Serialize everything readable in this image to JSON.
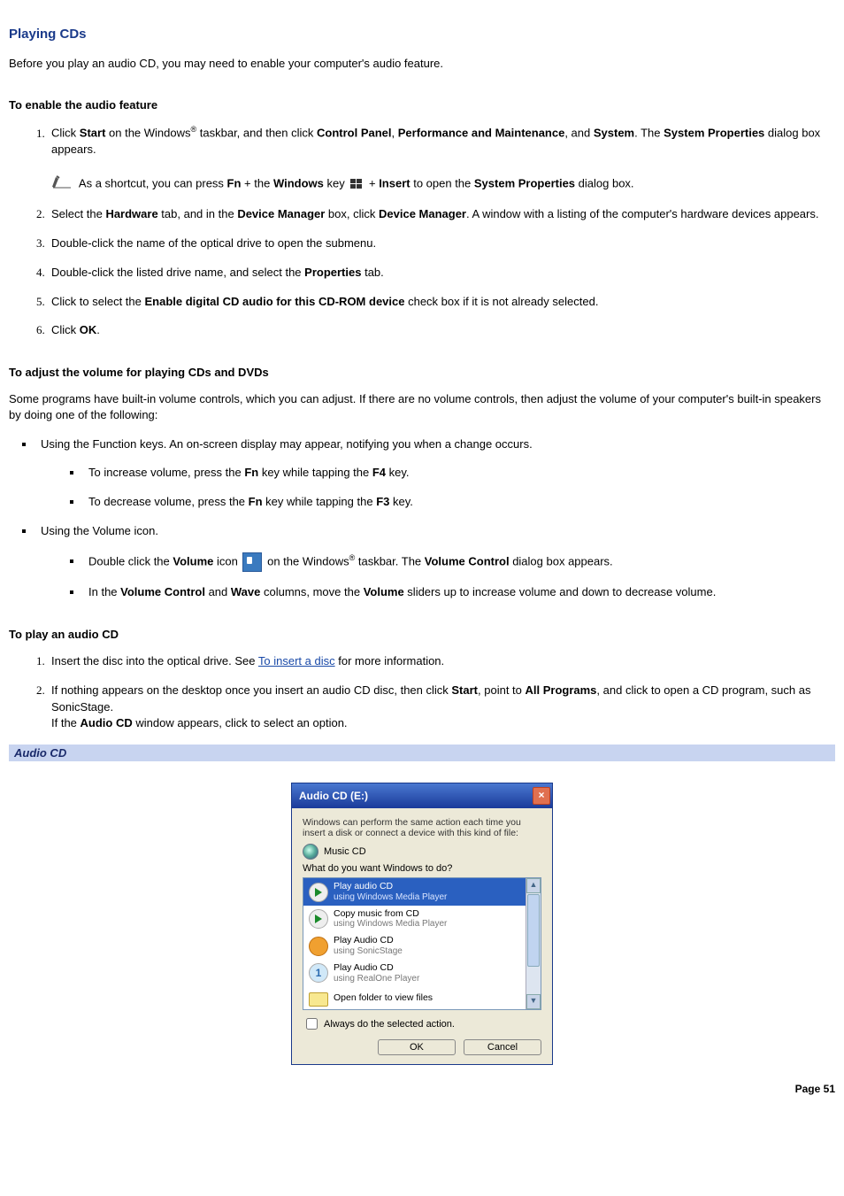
{
  "title": "Playing CDs",
  "intro": "Before you play an audio CD, you may need to enable your computer's audio feature.",
  "sec1_heading": "To enable the audio feature",
  "sec1": {
    "step1_a": "Click ",
    "step1_b": "Start",
    "step1_c": " on the Windows",
    "step1_sup": "®",
    "step1_d": " taskbar, and then click ",
    "step1_e": "Control Panel",
    "step1_f": ", ",
    "step1_g": "Performance and Maintenance",
    "step1_h": ", and ",
    "step1_i": "System",
    "step1_j": ". The ",
    "step1_k": "System Properties",
    "step1_l": " dialog box appears.",
    "note_a": "As a shortcut, you can press ",
    "note_b": "Fn",
    "note_c": " + the ",
    "note_d": "Windows",
    "note_e": " key ",
    "note_f": " + ",
    "note_g": "Insert",
    "note_h": " to open the ",
    "note_i": "System Properties",
    "note_j": " dialog box.",
    "step2_a": "Select the ",
    "step2_b": "Hardware",
    "step2_c": " tab, and in the ",
    "step2_d": "Device Manager",
    "step2_e": " box, click ",
    "step2_f": "Device Manager",
    "step2_g": ". A window with a listing of the computer's hardware devices appears.",
    "step3": "Double-click the name of the optical drive to open the submenu.",
    "step4_a": "Double-click the listed drive name, and select the ",
    "step4_b": "Properties",
    "step4_c": " tab.",
    "step5_a": "Click to select the ",
    "step5_b": "Enable digital CD audio for this CD-ROM device",
    "step5_c": " check box if it is not already selected.",
    "step6_a": "Click ",
    "step6_b": "OK",
    "step6_c": "."
  },
  "sec2_heading": "To adjust the volume for playing CDs and DVDs",
  "sec2_intro": "Some programs have built-in volume controls, which you can adjust. If there are no volume controls, then adjust the volume of your computer's built-in speakers by doing one of the following:",
  "sec2": {
    "b1": "Using the Function keys. An on-screen display may appear, notifying you when a change occurs.",
    "b1_s1_a": "To increase volume, press the ",
    "b1_s1_b": "Fn",
    "b1_s1_c": " key while tapping the ",
    "b1_s1_d": "F4",
    "b1_s1_e": " key.",
    "b1_s2_a": "To decrease volume, press the ",
    "b1_s2_b": "Fn",
    "b1_s2_c": " key while tapping the ",
    "b1_s2_d": "F3",
    "b1_s2_e": " key.",
    "b2": "Using the Volume icon.",
    "b2_s1_a": "Double click the ",
    "b2_s1_b": "Volume",
    "b2_s1_c": " icon ",
    "b2_s1_d": " on the Windows",
    "b2_s1_sup": "®",
    "b2_s1_e": " taskbar. The ",
    "b2_s1_f": "Volume Control",
    "b2_s1_g": " dialog box appears.",
    "b2_s2_a": "In the ",
    "b2_s2_b": "Volume Control",
    "b2_s2_c": " and ",
    "b2_s2_d": "Wave",
    "b2_s2_e": " columns, move the ",
    "b2_s2_f": "Volume",
    "b2_s2_g": " sliders up to increase volume and down to decrease volume."
  },
  "sec3_heading": "To play an audio CD",
  "sec3": {
    "step1_a": "Insert the disc into the optical drive. See ",
    "step1_link": "To insert a disc",
    "step1_b": " for more information.",
    "step2_a": "If nothing appears on the desktop once you insert an audio CD disc, then click ",
    "step2_b": "Start",
    "step2_c": ", point to ",
    "step2_d": "All Programs",
    "step2_e": ", and click to open a CD program, such as SonicStage.",
    "step2_line2_a": "If the ",
    "step2_line2_b": "Audio CD",
    "step2_line2_c": " window appears, click to select an option."
  },
  "caption": "Audio CD",
  "dialog": {
    "title": "Audio CD (E:)",
    "msg": "Windows can perform the same action each time you insert a disk or connect a device with this kind of file:",
    "kind": "Music CD",
    "prompt": "What do you want Windows to do?",
    "items": [
      {
        "main": "Play audio CD",
        "sub": "using Windows Media Player"
      },
      {
        "main": "Copy music from CD",
        "sub": "using Windows Media Player"
      },
      {
        "main": "Play Audio CD",
        "sub": "using SonicStage"
      },
      {
        "main": "Play Audio CD",
        "sub": "using RealOne Player"
      },
      {
        "main": "Open folder to view files",
        "sub": ""
      }
    ],
    "always": "Always do the selected action.",
    "ok": "OK",
    "cancel": "Cancel"
  },
  "page_number": "Page 51"
}
